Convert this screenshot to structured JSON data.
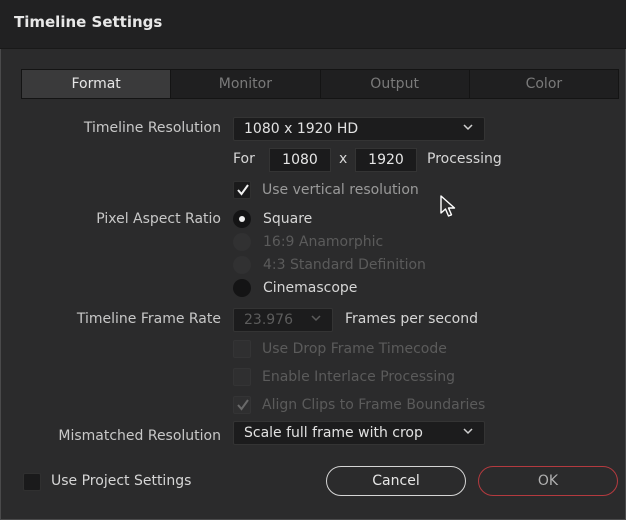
{
  "window": {
    "title": "Timeline Settings"
  },
  "tabs": [
    {
      "label": "Format"
    },
    {
      "label": "Monitor"
    },
    {
      "label": "Output"
    },
    {
      "label": "Color"
    }
  ],
  "resolution": {
    "label": "Timeline Resolution",
    "selected": "1080 x 1920 HD",
    "for_label": "For",
    "width": "1080",
    "x_label": "x",
    "height": "1920",
    "processing_label": "Processing",
    "vertical_label": "Use vertical resolution",
    "vertical_checked": true
  },
  "pixel_aspect": {
    "label": "Pixel Aspect Ratio",
    "options": [
      {
        "label": "Square",
        "selected": true,
        "enabled": true
      },
      {
        "label": "16:9 Anamorphic",
        "selected": false,
        "enabled": false
      },
      {
        "label": "4:3 Standard Definition",
        "selected": false,
        "enabled": false
      },
      {
        "label": "Cinemascope",
        "selected": false,
        "enabled": true
      }
    ]
  },
  "frame_rate": {
    "label": "Timeline Frame Rate",
    "selected": "23.976",
    "suffix": "Frames per second",
    "drop_frame_label": "Use Drop Frame Timecode",
    "interlace_label": "Enable Interlace Processing",
    "align_label": "Align Clips to Frame Boundaries",
    "align_checked": true
  },
  "mismatch": {
    "label": "Mismatched Resolution",
    "selected": "Scale full frame with crop"
  },
  "footer": {
    "project_settings_label": "Use Project Settings",
    "cancel_label": "Cancel",
    "ok_label": "OK"
  },
  "colors": {
    "ok_border": "#b43a3f",
    "dialog_bg": "#2b2b2c"
  }
}
